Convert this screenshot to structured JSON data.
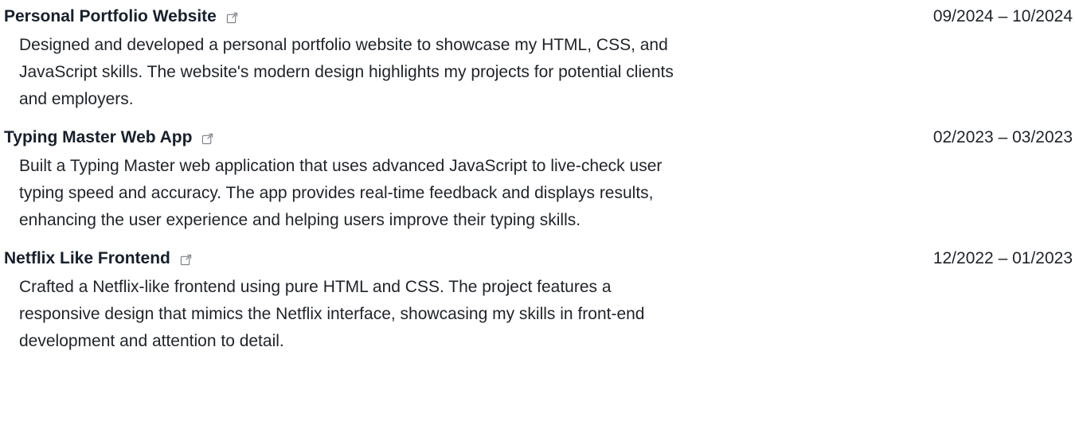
{
  "projects": [
    {
      "title": "Personal Portfolio Website",
      "date": "09/2024 – 10/2024",
      "description": "Designed and developed a personal portfolio website to showcase my HTML, CSS, and JavaScript skills. The website's modern design highlights my projects for potential clients and employers.",
      "icon": "external-link-icon"
    },
    {
      "title": "Typing Master Web App",
      "date": "02/2023 – 03/2023",
      "description": "Built a Typing Master web application that uses advanced JavaScript to live-check user typing speed and accuracy. The app provides real-time feedback and displays results, enhancing the user experience and helping users improve their typing skills.",
      "icon": "external-link-icon"
    },
    {
      "title": "Netflix Like Frontend",
      "date": "12/2022 – 01/2023",
      "description": "Crafted a Netflix-like frontend using pure HTML and CSS. The project features a responsive design that mimics the Netflix interface, showcasing my skills in front-end development and attention to detail.",
      "icon": "external-link-icon"
    }
  ],
  "colors": {
    "text": "#1f2329",
    "title": "#17202b",
    "icon": "#7a7f86"
  }
}
